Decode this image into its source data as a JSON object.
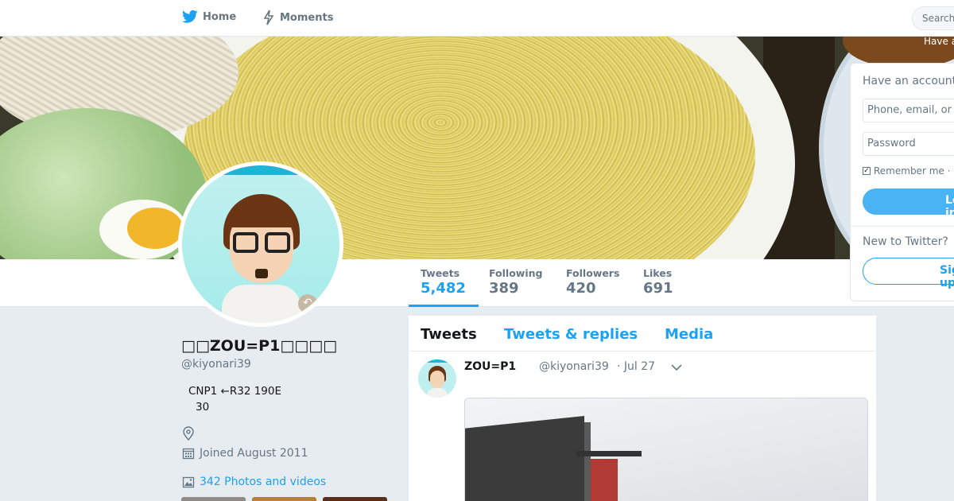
{
  "nav": {
    "home_label": "Home",
    "moments_label": "Moments",
    "search_placeholder": "Search",
    "have_account_peek": "Have a"
  },
  "profile": {
    "name": "□□ZOU=P1□□□□",
    "handle": "@kiyonari39",
    "bio_line1": "CNP1 ←R32 190E",
    "bio_line2": "30",
    "joined": "Joined August 2011",
    "photos_link": "342 Photos and videos"
  },
  "stats": {
    "tweets_label": "Tweets",
    "tweets_value": "5,482",
    "following_label": "Following",
    "following_value": "389",
    "followers_label": "Followers",
    "followers_value": "420",
    "likes_label": "Likes",
    "likes_value": "691"
  },
  "timeline": {
    "tabs": [
      "Tweets",
      "Tweets & replies",
      "Media"
    ],
    "tweet": {
      "name": "ZOU=P1",
      "handle": "@kiyonari39",
      "date": "· Jul 27"
    }
  },
  "login": {
    "heading": "Have an account?",
    "phone_placeholder": "Phone, email, or username",
    "password_placeholder": "Password",
    "remember_label": "Remember me ·",
    "login_button": "Log in",
    "new_label": "New to Twitter?",
    "signup_button": "Sign up"
  },
  "colors": {
    "accent": "#1da1f2",
    "background": "#e6ecf0",
    "text_secondary": "#657786"
  },
  "icons": [
    "twitter-bird-icon",
    "moments-bolt-icon",
    "location-icon",
    "calendar-icon",
    "photo-icon",
    "chevron-down-icon",
    "checkbox-icon",
    "avatar-badge-icon"
  ]
}
